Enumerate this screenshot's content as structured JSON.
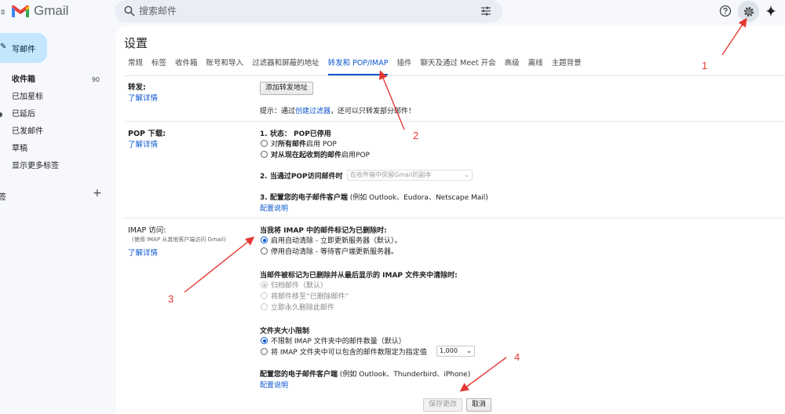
{
  "app": {
    "name": "Gmail",
    "brand_colors": [
      "#ea4335",
      "#4285f4",
      "#34a853",
      "#fbbc04",
      "#c5221f"
    ]
  },
  "search": {
    "placeholder": "搜索邮件"
  },
  "sidebar": {
    "compose_label": "写邮件",
    "items": [
      {
        "label": "收件箱",
        "count": "90",
        "bold": true
      },
      {
        "label": "已加星标"
      },
      {
        "label": "已延后"
      },
      {
        "label": "已发邮件"
      },
      {
        "label": "草稿"
      },
      {
        "label": "显示更多标签"
      }
    ],
    "labels_heading": "签"
  },
  "settings": {
    "title": "设置",
    "tabs": [
      "常规",
      "标签",
      "收件箱",
      "账号和导入",
      "过滤器和屏蔽的地址",
      "转发和 POP/IMAP",
      "插件",
      "聊天及通过 Meet 开会",
      "高级",
      "离线",
      "主题背景"
    ],
    "active_tab": "转发和 POP/IMAP",
    "forwarding": {
      "title": "转发:",
      "learn_more": "了解详情",
      "add_button": "添加转发地址",
      "tip_prefix": "提示：通过",
      "tip_link": "创建过滤器",
      "tip_suffix": "，还可以只转发部分邮件！"
    },
    "pop": {
      "title": "POP 下载:",
      "learn_more": "了解详情",
      "status_label": "1. 状态：",
      "status_value": "POP已停用",
      "option_all_prefix": "对",
      "option_all_bold": "所有邮件",
      "option_all_suffix": "启用 POP",
      "option_new_bold": "对从现在起收到的邮件",
      "option_new_suffix": "启用POP",
      "step2_label": "2. 当通过POP访问邮件时",
      "step2_select": "在收件箱中保留Gmail的副本",
      "step3_label": "3. 配置您的电子邮件客户端",
      "step3_hint": "(例如 Outlook、Eudora、Netscape Mail)",
      "config_link": "配置说明"
    },
    "imap": {
      "title": "IMAP 访问:",
      "subtitle": "(使用 IMAP 从其他客户端访问 Gmail)",
      "learn_more": "了解详情",
      "deleted_heading": "当我将 IMAP 中的邮件标记为已删除时:",
      "auto_expunge_on": "启用自动清除 - 立即更新服务器（默认）。",
      "auto_expunge_off": "停用自动清除 - 等待客户端更新服务器。",
      "expunge_heading": "当邮件被标记为已删除并从最后显示的 IMAP 文件夹中清除时:",
      "archive": "归档邮件（默认）",
      "move_trash": "将邮件移至“已删除邮件”",
      "delete_forever": "立即永久删除此邮件",
      "folder_heading": "文件夹大小限制",
      "no_limit": "不限制 IMAP 文件夹中的邮件数量（默认）",
      "limit_label": "将 IMAP 文件夹中可以包含的邮件数限定为指定值",
      "limit_value": "1,000",
      "client_heading": "配置您的电子邮件客户端",
      "client_hint": "(例如 Outlook、Thunderbird、iPhone)",
      "config_link": "配置说明"
    },
    "save_button": "保存更改",
    "cancel_button": "取消"
  },
  "annotations": {
    "color": "#e53935",
    "labels": [
      "1",
      "2",
      "3",
      "4"
    ]
  }
}
